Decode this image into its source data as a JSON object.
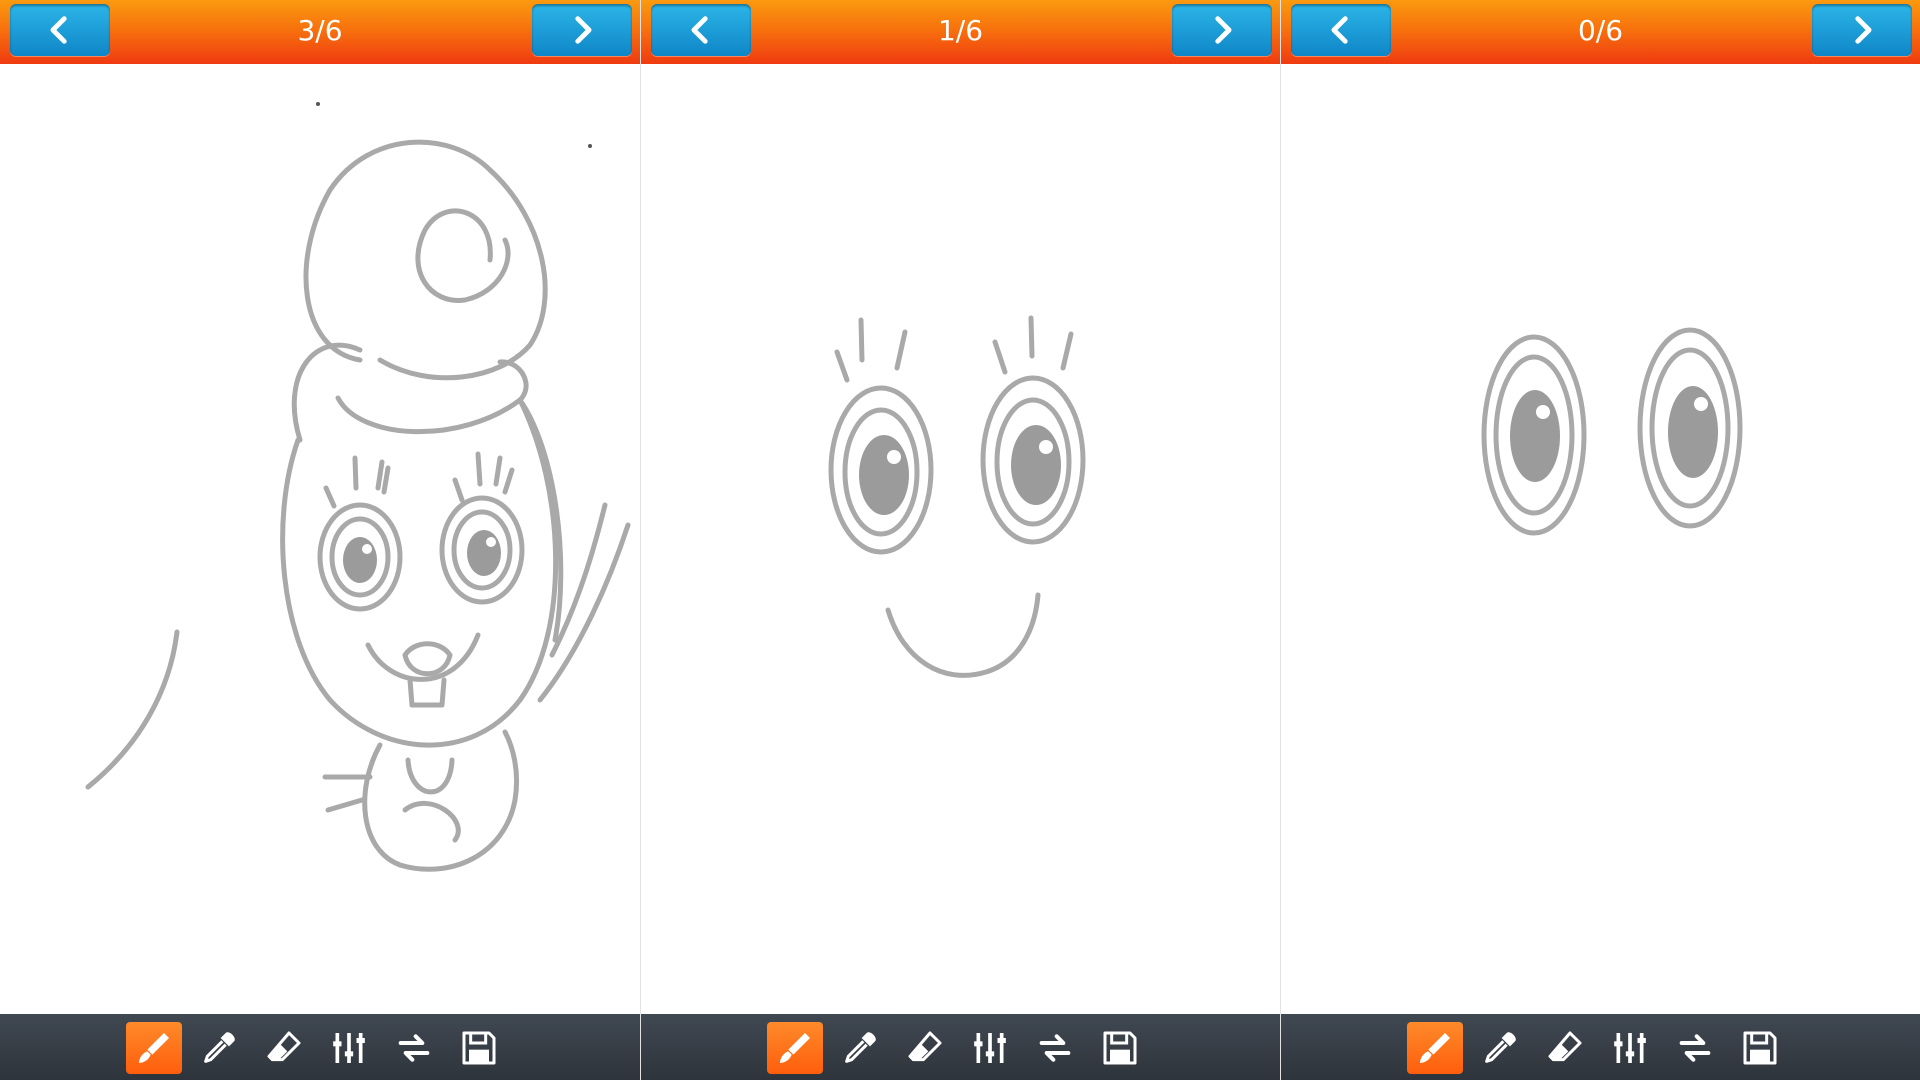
{
  "panels": [
    {
      "id": "p1",
      "page_counter": "3/6",
      "drawing": "full-character"
    },
    {
      "id": "p2",
      "page_counter": "1/6",
      "drawing": "eyes-and-smile"
    },
    {
      "id": "p3",
      "page_counter": "0/6",
      "drawing": "eyes-only"
    }
  ],
  "nav": {
    "prev_icon": "chevron-left-icon",
    "next_icon": "chevron-right-icon"
  },
  "toolbar": {
    "tools": [
      {
        "name": "brush-tool",
        "icon": "brush-icon",
        "active": true
      },
      {
        "name": "eyedropper-tool",
        "icon": "eyedropper-icon",
        "active": false
      },
      {
        "name": "eraser-tool",
        "icon": "eraser-icon",
        "active": false
      },
      {
        "name": "adjust-tool",
        "icon": "sliders-icon",
        "active": false
      },
      {
        "name": "flip-tool",
        "icon": "swap-icon",
        "active": false
      },
      {
        "name": "save-tool",
        "icon": "save-icon",
        "active": false
      }
    ]
  },
  "colors": {
    "topbar_top": "#fb9a0f",
    "topbar_bottom": "#ef3a10",
    "nav_button": "#1b9ad8",
    "toolbar_bg": "#373d44",
    "active_tool": "#ff6a16",
    "sketch_line": "#a9a9a9"
  }
}
